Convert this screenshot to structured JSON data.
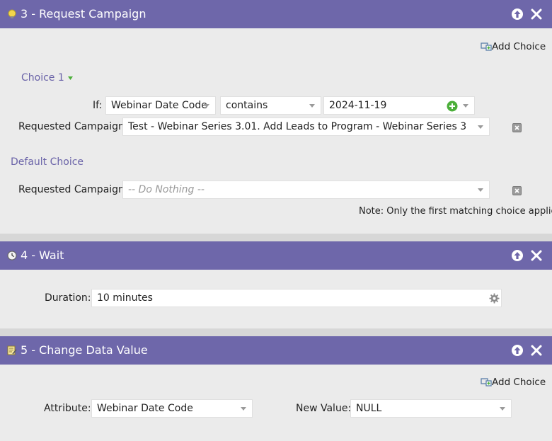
{
  "step3": {
    "title": "3 - Request Campaign",
    "add_choice": "Add Choice",
    "choice_label": "Choice 1",
    "if_label": "If:",
    "field": "Webinar Date Code",
    "operator": "contains",
    "value": "2024-11-19",
    "requested_label": "Requested Campaign:",
    "campaign": "Test - Webinar Series 3.01. Add Leads to Program - Webinar Series 3",
    "default_label": "Default Choice",
    "default_requested_label": "Requested Campaign:",
    "default_campaign_placeholder": "-- Do Nothing --",
    "note": "Note: Only the first matching choice applies"
  },
  "step4": {
    "title": "4 - Wait",
    "duration_label": "Duration:",
    "duration_value": "10 minutes"
  },
  "step5": {
    "title": "5 - Change Data Value",
    "add_choice": "Add Choice",
    "attribute_label": "Attribute:",
    "attribute_value": "Webinar Date Code",
    "new_value_label": "New Value:",
    "new_value": "NULL"
  },
  "colors": {
    "header_bg": "#6e67aa",
    "link": "#6a63a8",
    "panel_bg": "#ebebeb",
    "add_green": "#4caf3a"
  },
  "icons": {
    "step3": "lightbulb-icon",
    "step4": "clock-icon",
    "step5": "edit-note-icon",
    "move_up": "arrow-up-icon",
    "close": "close-icon",
    "add_choice": "add-choice-icon",
    "remove": "remove-icon",
    "add_value": "plus-circle-icon",
    "settings": "gear-icon"
  }
}
